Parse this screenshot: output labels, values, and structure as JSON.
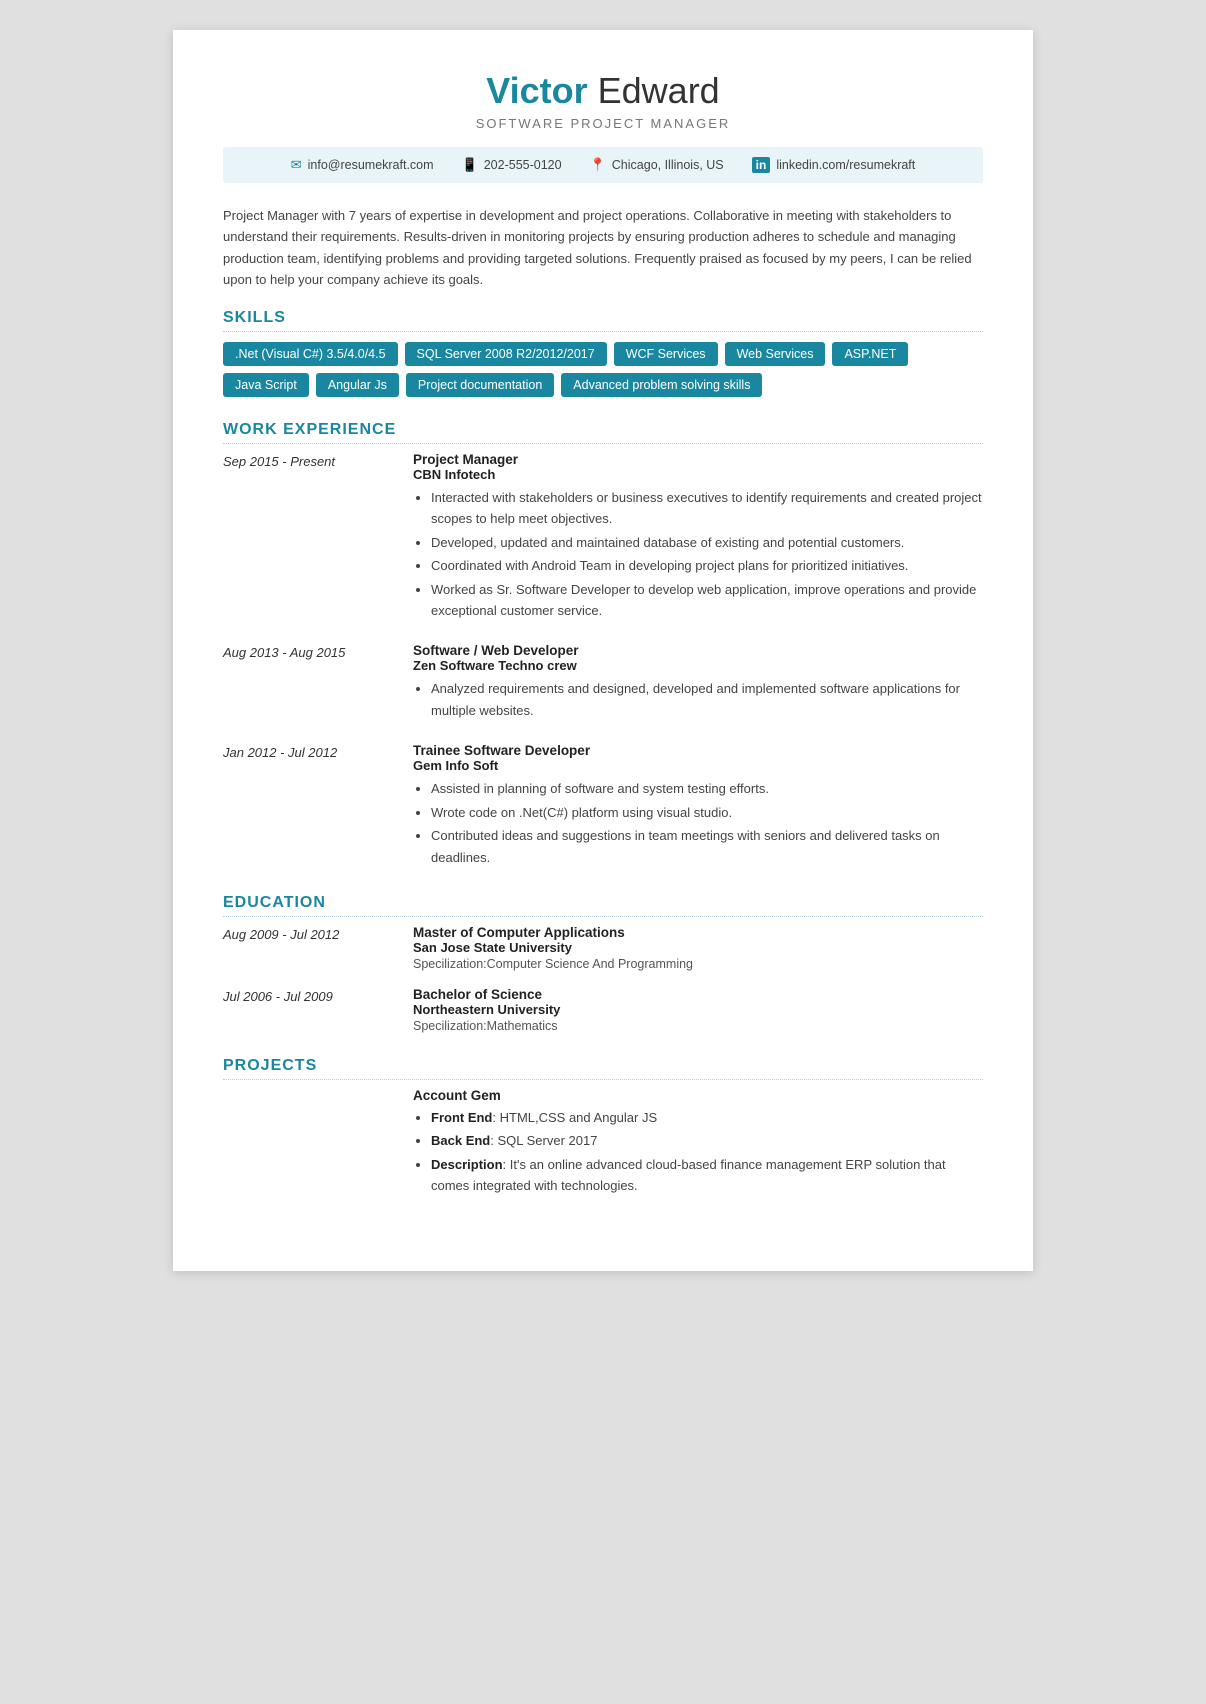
{
  "header": {
    "first_name": "Victor",
    "last_name": " Edward",
    "subtitle": "SOFTWARE PROJECT MANAGER"
  },
  "contact": {
    "email": "info@resumekraft.com",
    "phone": "202-555-0120",
    "location": "Chicago, Illinois, US",
    "linkedin": "linkedin.com/resumekraft",
    "email_icon": "✉",
    "phone_icon": "📱",
    "location_icon": "📍",
    "linkedin_icon": "in"
  },
  "summary": "Project Manager with 7 years of expertise in development and project operations. Collaborative in meeting with stakeholders to understand their requirements. Results-driven in monitoring projects by ensuring production adheres to schedule and managing production team, identifying problems and providing targeted solutions. Frequently praised as focused by my peers, I can be relied upon to help your company achieve its goals.",
  "skills": {
    "section_title": "SKILLS",
    "tags": [
      ".Net (Visual C#) 3.5/4.0/4.5",
      "SQL Server 2008 R2/2012/2017",
      "WCF Services",
      "Web Services",
      "ASP.NET",
      "Java Script",
      "Angular Js",
      "Project documentation",
      "Advanced problem solving skills"
    ]
  },
  "work_experience": {
    "section_title": "WORK EXPERIENCE",
    "entries": [
      {
        "date": "Sep 2015 - Present",
        "title": "Project Manager",
        "company": "CBN Infotech",
        "bullets": [
          "Interacted with stakeholders or business executives to identify requirements and created project scopes to help meet objectives.",
          "Developed, updated and maintained database of existing and potential customers.",
          "Coordinated with Android Team in developing project plans for prioritized initiatives.",
          "Worked as Sr. Software Developer to develop web application, improve operations and provide exceptional customer service."
        ]
      },
      {
        "date": "Aug 2013 - Aug 2015",
        "title": "Software / Web Developer",
        "company": "Zen Software Techno crew",
        "bullets": [
          "Analyzed requirements and designed, developed and implemented software applications for multiple websites."
        ]
      },
      {
        "date": "Jan 2012 - Jul 2012",
        "title": "Trainee Software Developer",
        "company": "Gem Info Soft",
        "bullets": [
          "Assisted in planning of software and system testing efforts.",
          "Wrote code on .Net(C#) platform using visual studio.",
          "Contributed ideas and suggestions in team meetings with seniors and delivered tasks on deadlines."
        ]
      }
    ]
  },
  "education": {
    "section_title": "EDUCATION",
    "entries": [
      {
        "date": "Aug 2009 - Jul 2012",
        "degree": "Master of Computer Applications",
        "school": "San Jose State University",
        "specialization": "Specilization:Computer Science And Programming"
      },
      {
        "date": "Jul 2006 - Jul 2009",
        "degree": "Bachelor of Science",
        "school": "Northeastern University",
        "specialization": "Specilization:Mathematics"
      }
    ]
  },
  "projects": {
    "section_title": "PROJECTS",
    "entries": [
      {
        "name": "Account Gem",
        "bullets": [
          {
            "label": "Front End",
            "text": ": HTML,CSS and Angular JS"
          },
          {
            "label": "Back End",
            "text": ": SQL Server 2017"
          },
          {
            "label": "Description",
            "text": ": It's an online advanced cloud-based finance management ERP solution that comes integrated with technologies."
          }
        ]
      }
    ]
  }
}
